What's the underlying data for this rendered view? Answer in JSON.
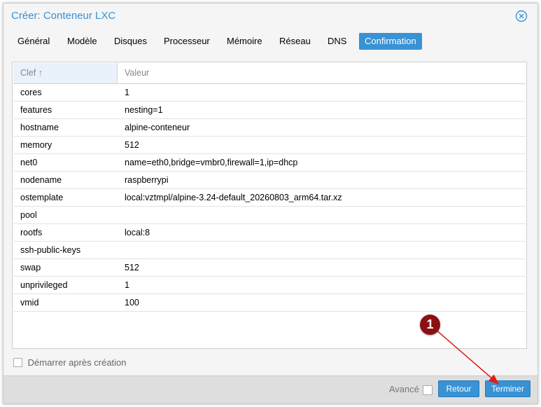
{
  "dialog": {
    "title": "Créer: Conteneur LXC"
  },
  "tabs": [
    {
      "label": "Général",
      "active": false
    },
    {
      "label": "Modèle",
      "active": false
    },
    {
      "label": "Disques",
      "active": false
    },
    {
      "label": "Processeur",
      "active": false
    },
    {
      "label": "Mémoire",
      "active": false
    },
    {
      "label": "Réseau",
      "active": false
    },
    {
      "label": "DNS",
      "active": false
    },
    {
      "label": "Confirmation",
      "active": true
    }
  ],
  "grid": {
    "columns": {
      "key": "Clef ↑",
      "value": "Valeur"
    },
    "rows": [
      {
        "key": "cores",
        "value": "1"
      },
      {
        "key": "features",
        "value": "nesting=1"
      },
      {
        "key": "hostname",
        "value": "alpine-conteneur"
      },
      {
        "key": "memory",
        "value": "512"
      },
      {
        "key": "net0",
        "value": "name=eth0,bridge=vmbr0,firewall=1,ip=dhcp"
      },
      {
        "key": "nodename",
        "value": "raspberrypi"
      },
      {
        "key": "ostemplate",
        "value": "local:vztmpl/alpine-3.24-default_20260803_arm64.tar.xz"
      },
      {
        "key": "pool",
        "value": ""
      },
      {
        "key": "rootfs",
        "value": "local:8"
      },
      {
        "key": "ssh-public-keys",
        "value": ""
      },
      {
        "key": "swap",
        "value": "512"
      },
      {
        "key": "unprivileged",
        "value": "1"
      },
      {
        "key": "vmid",
        "value": "100"
      }
    ]
  },
  "options": {
    "start_after_create": {
      "label": "Démarrer après création",
      "checked": false
    },
    "advanced": {
      "label": "Avancé",
      "checked": false
    }
  },
  "buttons": {
    "back": "Retour",
    "finish": "Terminer"
  },
  "annotation": {
    "marker_label": "1",
    "color": "#8b1012",
    "arrow_color": "#e01b1b"
  },
  "colors": {
    "accent": "#3892d4",
    "header_key_bg": "#e9f1fa"
  }
}
